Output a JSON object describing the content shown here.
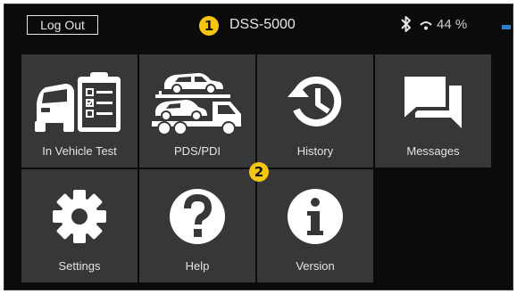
{
  "status_bar": {
    "logout_label": "Log Out",
    "device_name": "DSS-5000",
    "battery_text": "44 %",
    "icons": [
      "bluetooth-icon",
      "wifi-icon",
      "battery-icon"
    ],
    "battery_color": "#2f7fd0"
  },
  "callouts": {
    "marker_1": "1",
    "marker_2": "2",
    "color": "#f4c60f"
  },
  "menu": {
    "tile_color": "#373737",
    "tiles": [
      {
        "label": "In Vehicle Test",
        "icon": "vehicle-checklist-icon"
      },
      {
        "label": "PDS/PDI",
        "icon": "car-transporter-icon"
      },
      {
        "label": "History",
        "icon": "history-icon"
      },
      {
        "label": "Messages",
        "icon": "messages-icon"
      },
      {
        "label": "Settings",
        "icon": "gear-icon"
      },
      {
        "label": "Help",
        "icon": "help-icon"
      },
      {
        "label": "Version",
        "icon": "info-icon"
      }
    ]
  }
}
